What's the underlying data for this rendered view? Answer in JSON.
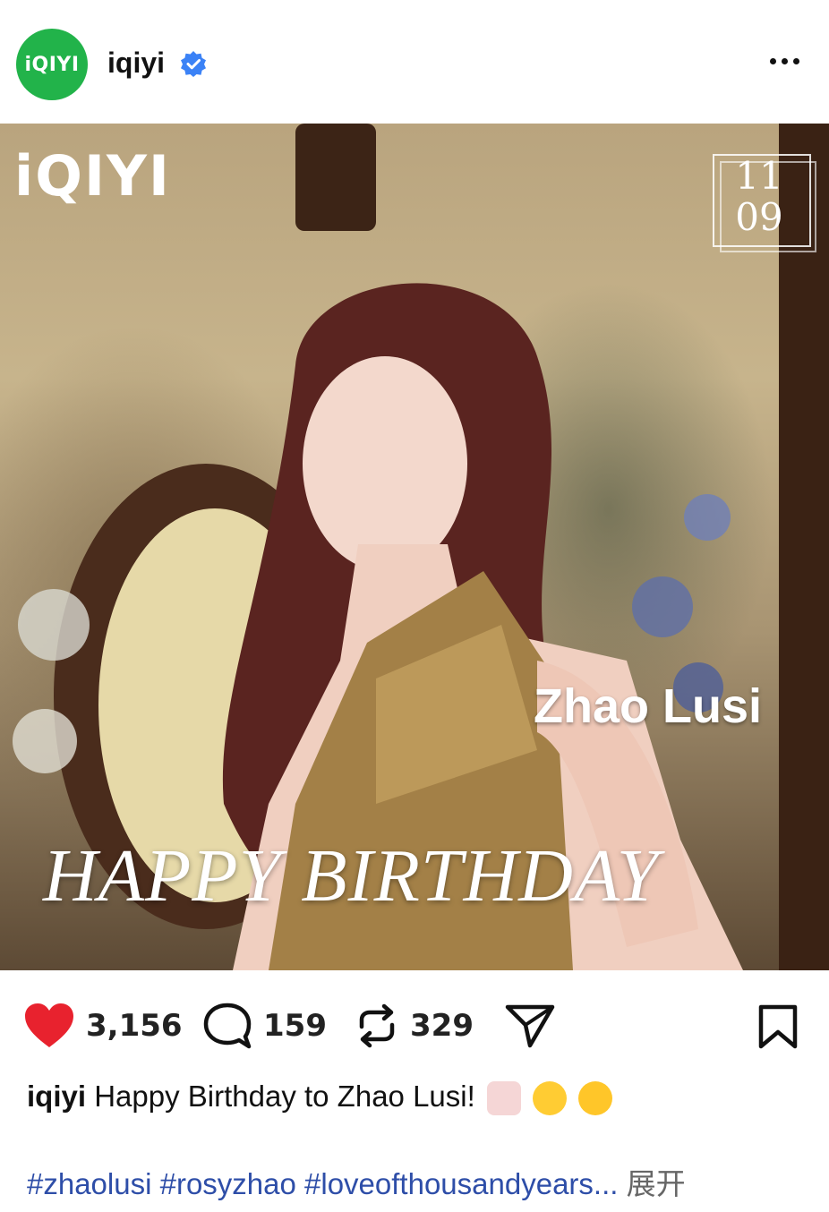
{
  "header": {
    "avatar_text": "iQIYI",
    "username": "iqiyi",
    "verified": true,
    "more_icon": "more-horizontal-icon"
  },
  "photo": {
    "brand_logo": "iQIYI",
    "date_month": "11",
    "date_day": "09",
    "name": "Zhao Lusi",
    "headline": "HAPPY BIRTHDAY"
  },
  "actions": {
    "likes": "3,156",
    "comments": "159",
    "reposts": "329",
    "like_color": "#e8222e"
  },
  "caption": {
    "author": "iqiyi",
    "text": "Happy Birthday to Zhao Lusi!",
    "emojis": [
      "birthday-cake-emoji",
      "partying-face-emoji",
      "star-struck-emoji"
    ]
  },
  "hashtags": {
    "text": "#zhaolusi #rosyzhao #loveofthousandyears...",
    "expand_label": "展开"
  },
  "colors": {
    "brand_green": "#22b34a",
    "hashtag_blue": "#2e4ea8",
    "verified_blue": "#3b82f6"
  }
}
